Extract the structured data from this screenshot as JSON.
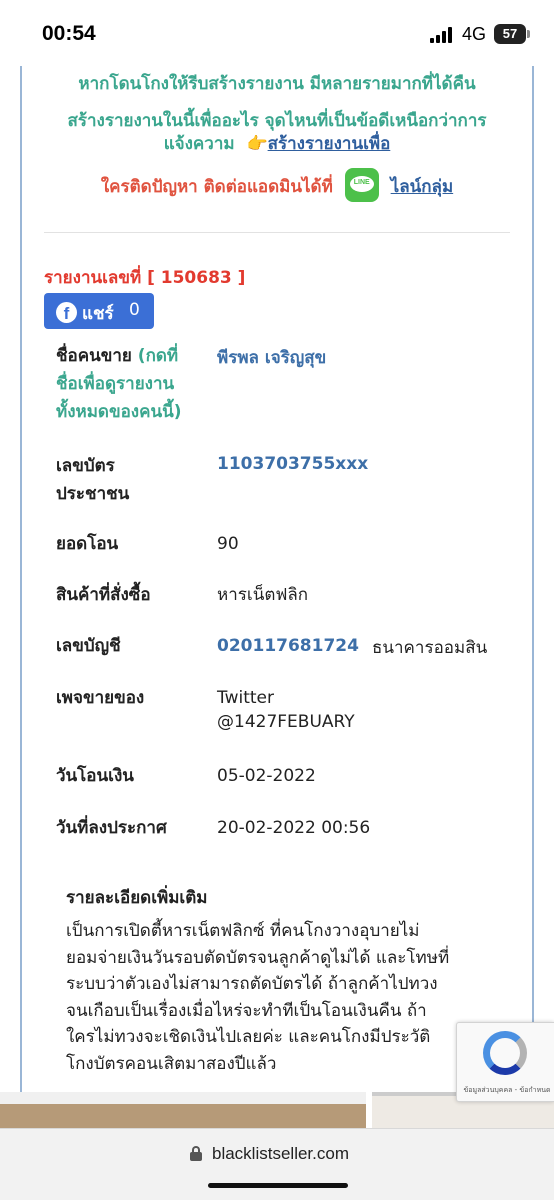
{
  "status_bar": {
    "time": "00:54",
    "network": "4G",
    "battery": "57"
  },
  "notices": {
    "line1": "หากโดนโกงให้รีบสร้างรายงาน มีหลายรายมากที่ได้คืน",
    "line2a": "สร้างรายงานในนี้เพื่ออะไร จุดไหนที่เป็นข้อดีเหนือกว่าการ",
    "line2b": "แจ้งความ",
    "pointer": "👉",
    "line2_link": "สร้างรายงานเพื่อ",
    "line3": "ใครติดปัญหา ติดต่อแอดมินได้ที่",
    "line_icon_text": "LINE",
    "line3_link": "ไลน์กลุ่ม"
  },
  "report": {
    "number_label": "รายงานเลขที่ [ 150683 ]",
    "share_label": "แชร์",
    "share_count": "0",
    "fields": {
      "seller_label": "ชื่อคนขาย",
      "seller_hint_1": "(กดที่",
      "seller_hint_2": "ชื่อเพื่อดูรายงาน",
      "seller_hint_3": "ทั้งหมดของคนนี้)",
      "seller_value": "พีรพล เจริญสุข",
      "id_label_1": "เลขบัตร",
      "id_label_2": "ประชาชน",
      "id_value": "1103703755xxx",
      "amount_label": "ยอดโอน",
      "amount_value": "90",
      "product_label": "สินค้าที่สั่งซื้อ",
      "product_value": "หารเน็ตฟลิก",
      "account_label": "เลขบัญชี",
      "account_value": "020117681724",
      "bank_value": "ธนาคารออมสิน",
      "page_label": "เพจขายของ",
      "page_value_1": "Twitter",
      "page_value_2": "@1427FEBUARY",
      "transfer_date_label": "วันโอนเงิน",
      "transfer_date_value": "05-02-2022",
      "posted_label": "วันที่ลงประกาศ",
      "posted_value": "20-02-2022 00:56"
    },
    "details_title": "รายละเอียดเพิ่มเติม",
    "details_lines": [
      "เป็นการเปิดตี้หารเน็ตฟลิกซ์ ที่คนโกงวางอุบายไม่",
      "ยอมจ่ายเงินวันรอบตัดบัตรจนลูกค้าดูไม่ได้ และโทษที่",
      "ระบบว่าตัวเองไม่สามารถตัดบัตรได้ ถ้าลูกค้าไปทวง",
      "จนเกือบเป็นเรื่องเมื่อไหร่จะทำทีเป็นโอนเงินคืน ถ้า",
      "ใครไม่ทวงจะเชิดเงินไปเลยค่ะ และคนโกงมีประวัติ",
      "โกงบัตรคอนเสิตมาสองปีแล้ว"
    ]
  },
  "recaptcha": {
    "text": "ข้อมูลส่วนบุคคล - ข้อกำหนด"
  },
  "browser": {
    "url": "blacklistseller.com"
  }
}
